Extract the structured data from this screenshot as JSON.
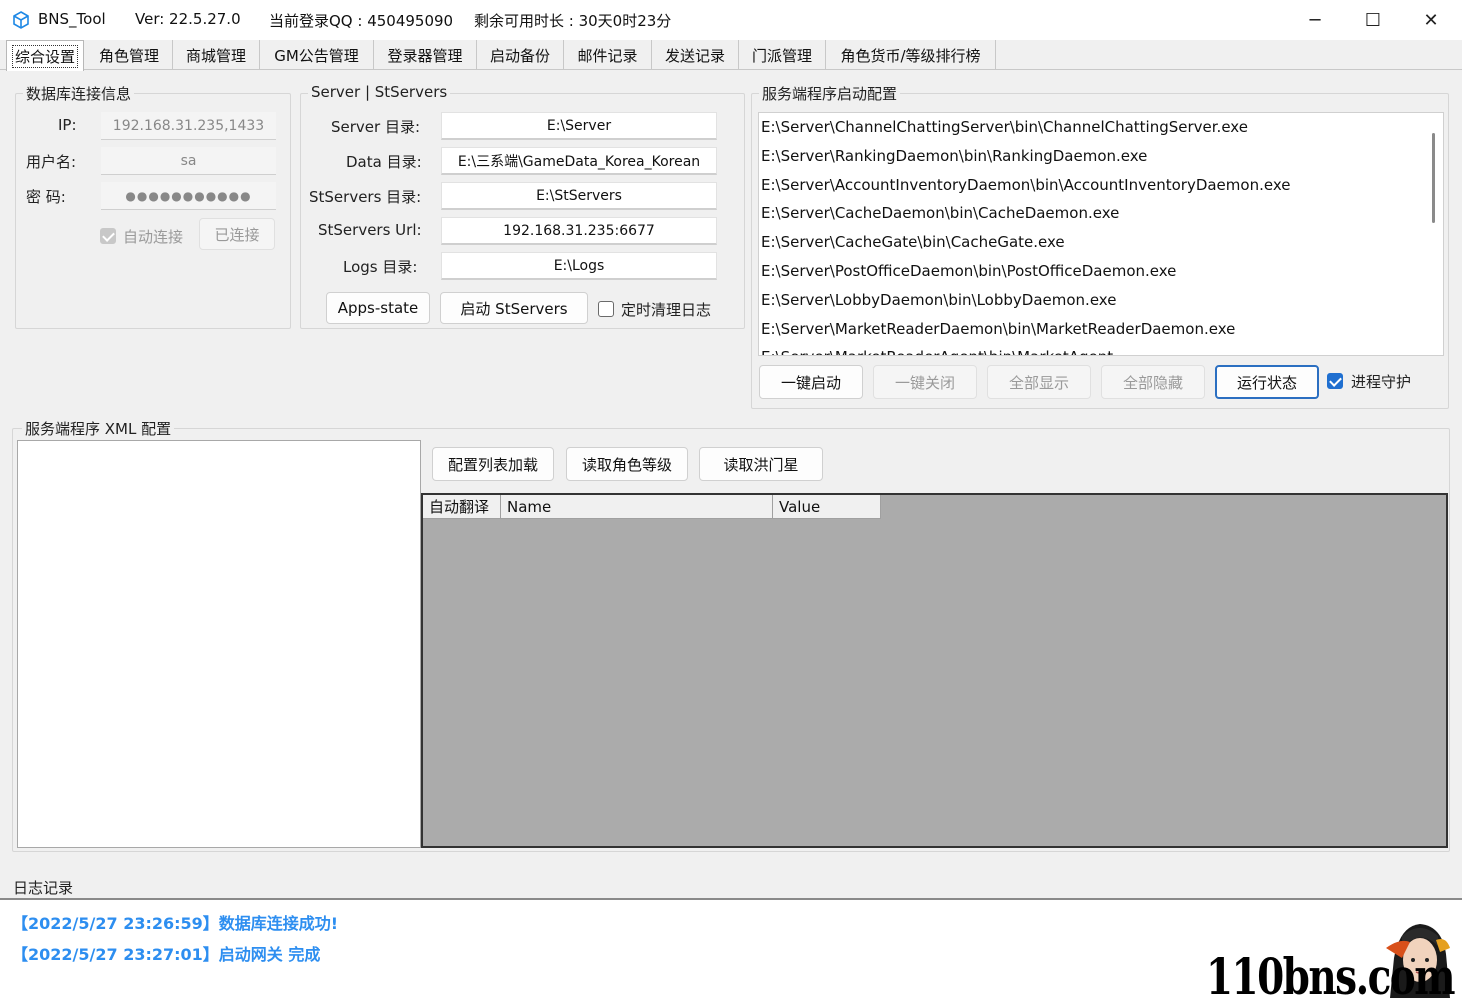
{
  "titlebar": {
    "app_name": "BNS_Tool",
    "version": "Ver:  22.5.27.0",
    "login": "当前登录QQ : 450495090",
    "remaining": "剩余可用时长 : 30天0时23分",
    "minimize": "─",
    "maximize": "☐",
    "close": "✕"
  },
  "tabs": [
    "综合设置",
    "角色管理",
    "商城管理",
    "GM公告管理",
    "登录器管理",
    "启动备份",
    "邮件记录",
    "发送记录",
    "门派管理",
    "角色货币/等级排行榜"
  ],
  "db": {
    "title": "数据库连接信息",
    "ip_label": "IP:",
    "ip_value": "192.168.31.235,1433",
    "user_label": "用户名:",
    "user_value": "sa",
    "pass_label": "密    码:",
    "pass_value": "●●●●●●●●●●●",
    "auto_connect": "自动连接",
    "connected": "已连接"
  },
  "server": {
    "title": "Server | StServers",
    "server_label": "Server 目录:",
    "server_value": "E:\\Server",
    "data_label": "Data 目录:",
    "data_value": "E:\\三系端\\GameData_Korea_Korean",
    "st_label": "StServers 目录:",
    "st_value": "E:\\StServers",
    "url_label": "StServers Url:",
    "url_value": "192.168.31.235:6677",
    "logs_label": "Logs 目录:",
    "logs_value": "E:\\Logs",
    "apps_state": "Apps-state",
    "start_st": "启动 StServers",
    "clean_log": "定时清理日志"
  },
  "launch": {
    "title": "服务端程序启动配置",
    "items": [
      "E:\\Server\\ChannelChattingServer\\bin\\ChannelChattingServer.exe",
      "E:\\Server\\RankingDaemon\\bin\\RankingDaemon.exe",
      "E:\\Server\\AccountInventoryDaemon\\bin\\AccountInventoryDaemon.exe",
      "E:\\Server\\CacheDaemon\\bin\\CacheDaemon.exe",
      "E:\\Server\\CacheGate\\bin\\CacheGate.exe",
      "E:\\Server\\PostOfficeDaemon\\bin\\PostOfficeDaemon.exe",
      "E:\\Server\\LobbyDaemon\\bin\\LobbyDaemon.exe",
      "E:\\Server\\MarketReaderDaemon\\bin\\MarketReaderDaemon.exe",
      "E:\\Server\\MarketReaderAgent\\bin\\MarketAgent..."
    ],
    "start_all": "一键启动",
    "stop_all": "一键关闭",
    "show_all": "全部显示",
    "hide_all": "全部隐藏",
    "status": "运行状态",
    "guard": "进程守护"
  },
  "xml": {
    "title": "服务端程序 XML 配置",
    "load_list": "配置列表加载",
    "read_level": "读取角色等级",
    "read_hongmen": "读取洪门星",
    "col_translate": "自动翻译",
    "col_name": "Name",
    "col_value": "Value"
  },
  "log": {
    "title": "日志记录",
    "lines": [
      "【2022/5/27 23:26:59】数据库连接成功!",
      "【2022/5/27 23:27:01】启动网关 完成"
    ]
  },
  "watermark": "110bns.com",
  "colors": {
    "accent": "#1f6fd0",
    "log_text": "#2d8ef0",
    "grid_bg": "#ababab"
  }
}
